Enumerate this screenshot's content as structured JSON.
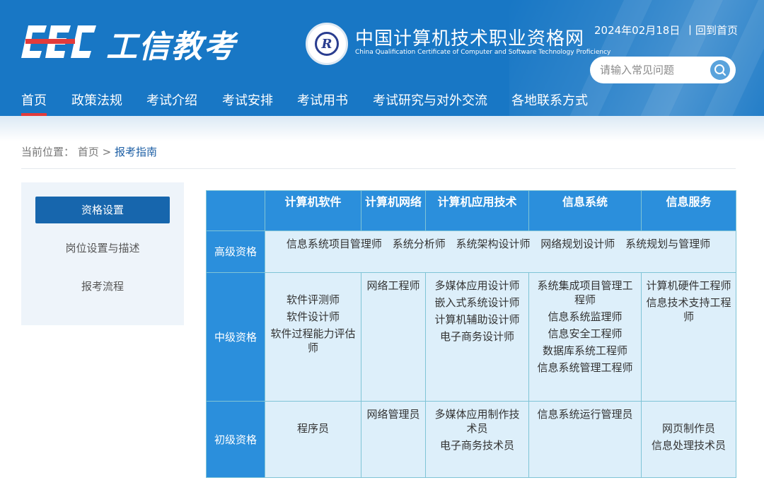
{
  "brand": {
    "logo_text": "工信教考",
    "logo_mark": "CEC"
  },
  "site": {
    "title": "中国计算机技术职业资格网",
    "subtitle": "China Qualification Certificate of Computer and Software Technology Proficiency",
    "date": "2024年02月18日",
    "home_link": "丨回到首页"
  },
  "search": {
    "placeholder": "请输入常见问题",
    "icon": "search-icon"
  },
  "nav": {
    "items": [
      {
        "label": "首页"
      },
      {
        "label": "政策法规"
      },
      {
        "label": "考试介绍"
      },
      {
        "label": "考试安排"
      },
      {
        "label": "考试用书"
      },
      {
        "label": "考试研究与对外交流"
      },
      {
        "label": "各地联系方式"
      }
    ],
    "active": "首页"
  },
  "breadcrumb": {
    "prefix": "当前位置：",
    "home": "首页",
    "separator": ">",
    "current": "报考指南"
  },
  "sidebar": {
    "items": [
      {
        "label": "资格设置"
      },
      {
        "label": "岗位设置与描述"
      },
      {
        "label": "报考流程"
      }
    ],
    "active": "资格设置"
  },
  "table": {
    "columns": [
      "",
      "计算机软件",
      "计算机网络",
      "计算机应用技术",
      "信息系统",
      "信息服务"
    ],
    "rows": [
      {
        "level": "高级资格",
        "merged": [
          "信息系统项目管理师",
          "系统分析师",
          "系统架构设计师",
          "网络规划设计师",
          "系统规划与管理师"
        ]
      },
      {
        "level": "中级资格",
        "cells": [
          [
            "软件评测师",
            "软件设计师",
            "软件过程能力评估师"
          ],
          [
            "网络工程师"
          ],
          [
            "多媒体应用设计师",
            "嵌入式系统设计师",
            "计算机辅助设计师",
            "电子商务设计师"
          ],
          [
            "系统集成项目管理工程师",
            "信息系统监理师",
            "信息安全工程师",
            "数据库系统工程师",
            "信息系统管理工程师"
          ],
          [
            "计算机硬件工程师",
            "信息技术支持工程师"
          ]
        ]
      },
      {
        "level": "初级资格",
        "cells": [
          [
            "程序员"
          ],
          [
            "网络管理员"
          ],
          [
            "多媒体应用制作技术员",
            "电子商务技术员"
          ],
          [
            "信息系统运行管理员"
          ],
          [
            "网页制作员",
            "信息处理技术员"
          ]
        ]
      }
    ]
  },
  "colors": {
    "header": "#1877c5",
    "accent": "#1766ad",
    "table_head": "#2b8fdc",
    "table_cell": "#ddeffa",
    "nav_active": "#e23b3b"
  }
}
